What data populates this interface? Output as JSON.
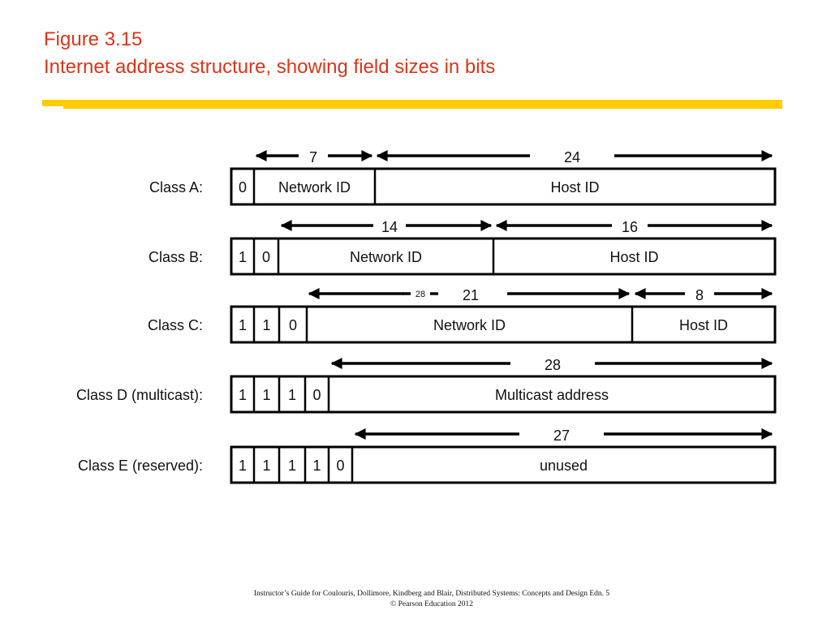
{
  "slide": {
    "figure_number": "Figure 3.15",
    "title": "Internet address structure, showing field sizes in bits",
    "accent_color": "#ffcc00",
    "title_color": "#d7361a"
  },
  "diagram": {
    "rows": [
      {
        "label": "Class A:",
        "fields": [
          {
            "text": "0",
            "kind": "bit"
          },
          {
            "text": "Network ID",
            "kind": "field",
            "bits": 7
          },
          {
            "text": "Host ID",
            "kind": "field",
            "bits": 24
          }
        ],
        "spans": [
          {
            "label": "7"
          },
          {
            "label": "24"
          }
        ]
      },
      {
        "label": "Class B:",
        "fields": [
          {
            "text": "1",
            "kind": "bit"
          },
          {
            "text": "0",
            "kind": "bit"
          },
          {
            "text": "Network ID",
            "kind": "field",
            "bits": 14
          },
          {
            "text": "Host ID",
            "kind": "field",
            "bits": 16
          }
        ],
        "spans": [
          {
            "label": "14"
          },
          {
            "label": "16"
          }
        ]
      },
      {
        "label": "Class C:",
        "fields": [
          {
            "text": "1",
            "kind": "bit"
          },
          {
            "text": "1",
            "kind": "bit"
          },
          {
            "text": "0",
            "kind": "bit"
          },
          {
            "text": "Network ID",
            "kind": "field",
            "bits": 21
          },
          {
            "text": "Host ID",
            "kind": "field",
            "bits": 8
          }
        ],
        "spans": [
          {
            "label": "21",
            "note": "28"
          },
          {
            "label": "8"
          }
        ]
      },
      {
        "label": "Class D (multicast):",
        "fields": [
          {
            "text": "1",
            "kind": "bit"
          },
          {
            "text": "1",
            "kind": "bit"
          },
          {
            "text": "1",
            "kind": "bit"
          },
          {
            "text": "0",
            "kind": "bit"
          },
          {
            "text": "Multicast address",
            "kind": "field",
            "bits": 28
          }
        ],
        "spans": [
          {
            "label": "28"
          }
        ]
      },
      {
        "label": "Class E (reserved):",
        "fields": [
          {
            "text": "1",
            "kind": "bit"
          },
          {
            "text": "1",
            "kind": "bit"
          },
          {
            "text": "1",
            "kind": "bit"
          },
          {
            "text": "1",
            "kind": "bit"
          },
          {
            "text": "0",
            "kind": "bit"
          },
          {
            "text": "unused",
            "kind": "field",
            "bits": 27
          }
        ],
        "spans": [
          {
            "label": "27"
          }
        ]
      }
    ]
  },
  "footer": {
    "line1": "Instructor’s Guide for  Coulouris, Dollimore, Kindberg and Blair,  Distributed Systems: Concepts and Design   Edn. 5",
    "line2": "©  Pearson Education 2012"
  }
}
